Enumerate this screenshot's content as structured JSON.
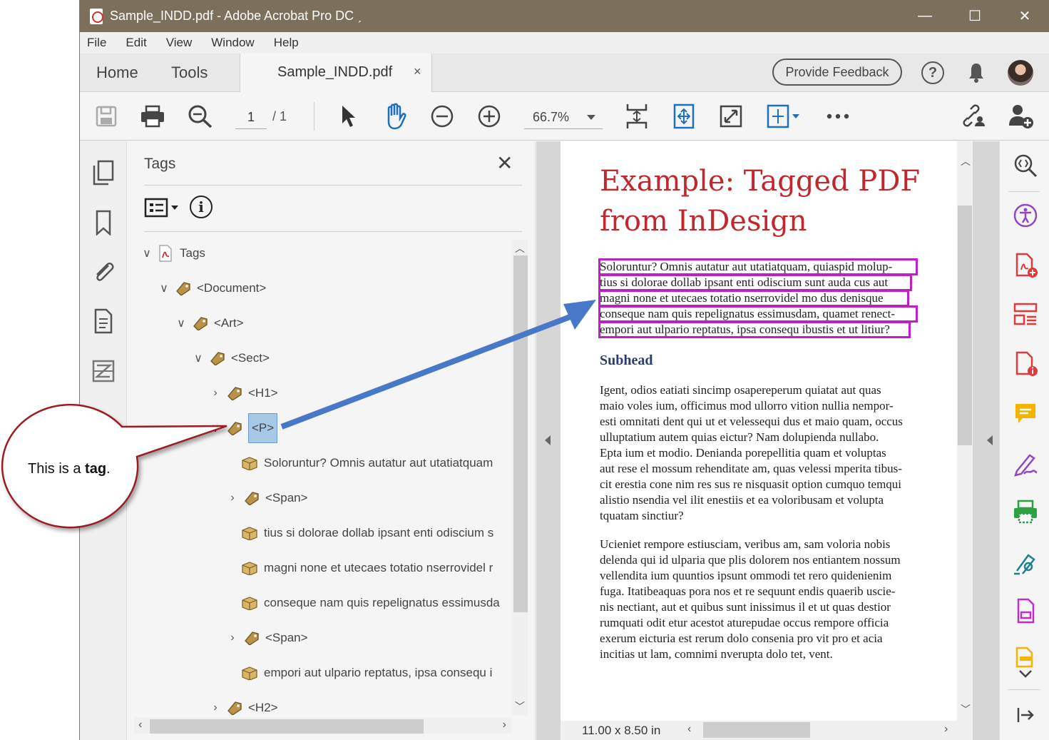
{
  "window": {
    "title": "Sample_INDD.pdf - Adobe Acrobat Pro DC ˏ",
    "controls": [
      "—",
      "☐",
      "✕"
    ]
  },
  "menu": [
    "File",
    "Edit",
    "View",
    "Window",
    "Help"
  ],
  "tabs": {
    "home": "Home",
    "tools": "Tools",
    "document": "Sample_INDD.pdf",
    "close": "×"
  },
  "header": {
    "feedback": "Provide Feedback",
    "help": "?"
  },
  "toolbar": {
    "page_current": "1",
    "page_total": "/  1",
    "zoom": "66.7%"
  },
  "tags_panel": {
    "title": "Tags",
    "close": "✕",
    "info": "i",
    "tree": [
      {
        "label": "Tags",
        "chev": "∨",
        "icon": "pdf"
      },
      {
        "label": "<Document>",
        "chev": "∨",
        "icon": "tag"
      },
      {
        "label": "<Art>",
        "chev": "∨",
        "icon": "tag"
      },
      {
        "label": "<Sect>",
        "chev": "∨",
        "icon": "tag"
      },
      {
        "label": "<H1>",
        "chev": "›",
        "icon": "tag"
      },
      {
        "label": "<P>",
        "chev": "∨",
        "icon": "tag",
        "selected": true
      },
      {
        "label": "Soloruntur? Omnis autatur aut utatiatquam",
        "chev": "",
        "icon": "box"
      },
      {
        "label": "<Span>",
        "chev": "›",
        "icon": "tag"
      },
      {
        "label": "tius si dolorae dollab ipsant enti odiscium s",
        "chev": "",
        "icon": "box"
      },
      {
        "label": "magni none et utecaes totatio nserrovidel r",
        "chev": "",
        "icon": "box"
      },
      {
        "label": "conseque nam quis repelignatus essimusda",
        "chev": "",
        "icon": "box"
      },
      {
        "label": "<Span>",
        "chev": "›",
        "icon": "tag"
      },
      {
        "label": "empori aut ulpario reptatus, ipsa consequ i",
        "chev": "",
        "icon": "box"
      },
      {
        "label": "<H2>",
        "chev": "›",
        "icon": "tag"
      }
    ]
  },
  "document": {
    "title_line1": "Example: Tagged PDF",
    "title_line2": "from InDesign",
    "highlighted_lines": [
      "Soloruntur? Omnis autatur aut utatiatquam, quiaspid molup-",
      "tius si dolorae dollab ipsant enti odiscium sunt auda cus aut",
      "magni none et utecaes totatio nserrovidel mo dus denisque",
      "conseque nam quis repelignatus essimusdam, quamet renect-",
      "empori aut ulpario reptatus, ipsa consequ ibustis et ut litiur?"
    ],
    "subhead": "Subhead",
    "para2": [
      "Igent, odios eatiati sincimp osapereperum quiatat aut quas",
      "maio voles ium, officimus mod ullorro vition nullia nempor-",
      "esti omnitati dent qui ut et velessequi dus et maio quam, occus",
      "ulluptatium autem quias eictur? Nam dolupienda nullabo.",
      "Epta ium et modio. Denianda porepellitia quam et voluptas",
      "aut rese el mossum rehenditate am, quas velessi mperita tibus-",
      "cit erestia cone nim res sus re nisquasit option cumquo temqui",
      "alistio nsendia vel ilit enestiis et ea voloribusam et volupta",
      "tquatam sinctiur?"
    ],
    "para3": [
      "Ucieniet rempore estiusciam, veribus am, sam voloria nobis",
      "delenda qui id ulparia que plis dolorem nos entiantem nossum",
      "vellendita ium quuntios ipsunt ommodi tet rero quidenienim",
      "fuga. Itatibeaquas pora nos et re sequunt endis quaerib uscie-",
      "nis nectiant, aut et quibus sunt inissimus il et ut quas destior",
      "rumquati odit etur acestot aturepudae occus rempore officia",
      "exerum eicturia est rerum dolo consenia pro vit pro et acia",
      "incitias ut lam, comnimi nverupta dolo tet, vent."
    ],
    "page_size": "11.00 x 8.50 in"
  },
  "callout": {
    "text_prefix": "This is a ",
    "text_bold": "tag",
    "text_suffix": "."
  },
  "colors": {
    "titlebar": "#7c6f5b",
    "heading_red": "#c0282d",
    "subhead_blue": "#2b3c73",
    "highlight_magenta": "#c21ec8",
    "arrow_blue": "#4a78c8",
    "callout_border": "#9b1c24"
  }
}
